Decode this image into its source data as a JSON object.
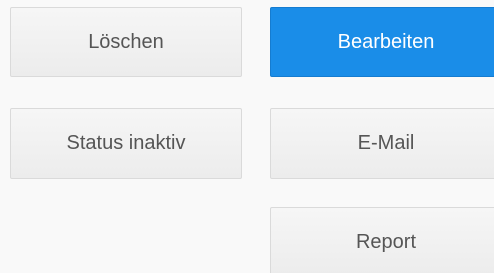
{
  "actions": {
    "delete_label": "Löschen",
    "edit_label": "Bearbeiten",
    "status_label": "Status inaktiv",
    "email_label": "E-Mail",
    "report_label": "Report"
  },
  "colors": {
    "primary": "#1a8de8",
    "background": "#f9f9f9"
  }
}
